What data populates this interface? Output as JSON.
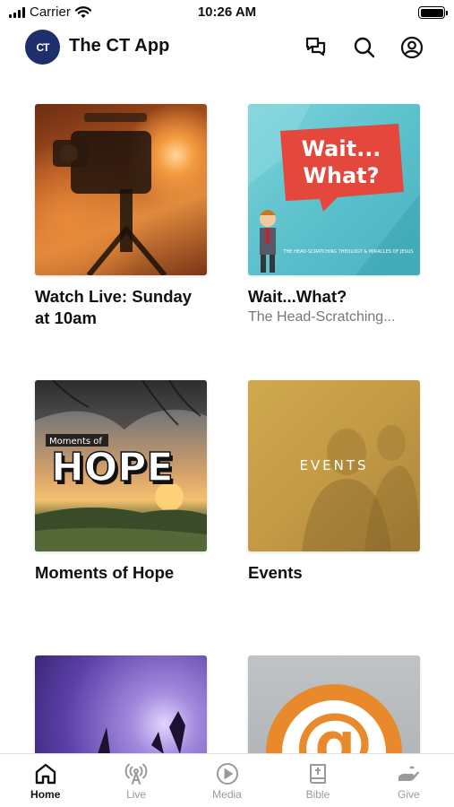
{
  "status_bar": {
    "carrier": "Carrier",
    "time": "10:26 AM"
  },
  "header": {
    "title": "The CT App",
    "logo_text": "CT",
    "icons": [
      "chat-bubbles-icon",
      "search-icon",
      "account-icon"
    ]
  },
  "cards": [
    {
      "title": "Watch Live: Sunday at 10am",
      "subtitle": ""
    },
    {
      "title": "Wait...What?",
      "subtitle": "The Head-Scratching...",
      "art_heading": "Wait... What?",
      "art_caption": "THE HEAD-SCRATCHING THEOLOGY & MIRACLES OF JESUS"
    },
    {
      "title": "Moments of Hope",
      "subtitle": "",
      "art_small": "Moments of",
      "art_big": "HOPE"
    },
    {
      "title": "Events",
      "subtitle": "",
      "art_label": "EVENTS"
    },
    {
      "title": "",
      "subtitle": ""
    },
    {
      "title": "",
      "subtitle": "",
      "art_symbol": "@"
    }
  ],
  "tabs": [
    {
      "label": "Home",
      "icon": "home-icon",
      "active": true
    },
    {
      "label": "Live",
      "icon": "broadcast-icon",
      "active": false
    },
    {
      "label": "Media",
      "icon": "play-circle-icon",
      "active": false
    },
    {
      "label": "Bible",
      "icon": "bible-icon",
      "active": false
    },
    {
      "label": "Give",
      "icon": "give-hand-icon",
      "active": false
    }
  ],
  "colors": {
    "logo_bg": "#1e2f6b",
    "tab_active": "#111111",
    "tab_inactive": "#9a9a9a",
    "wait_banner": "#e4473b",
    "contact_orange": "#e88a2c"
  }
}
